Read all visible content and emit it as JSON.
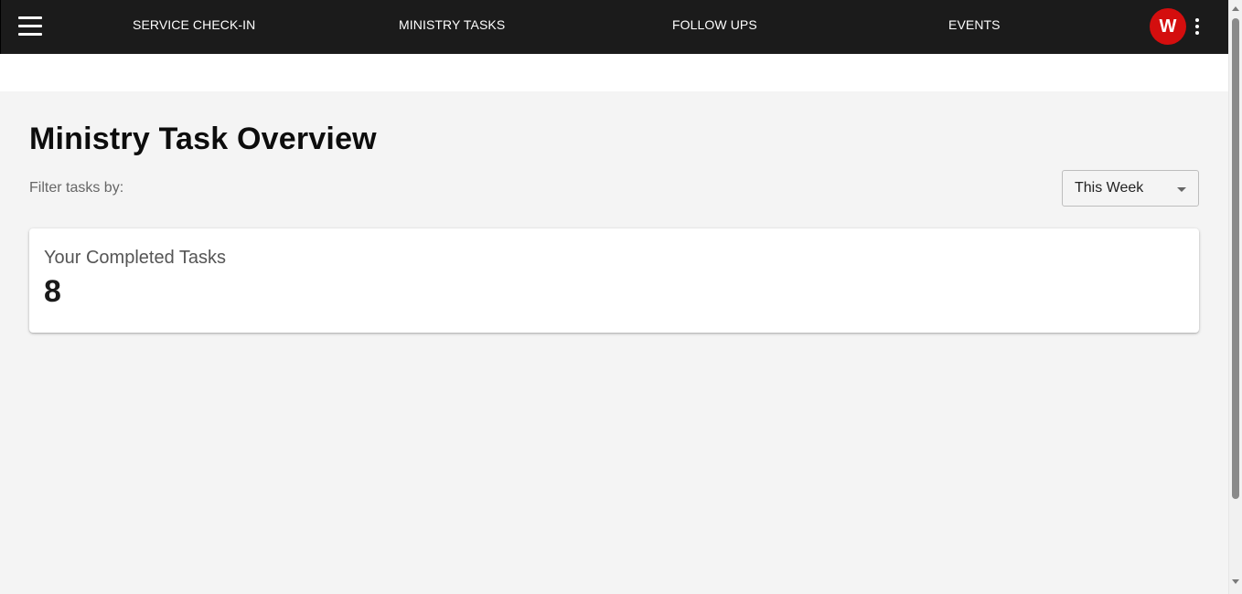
{
  "header": {
    "menu_icon": "hamburger-menu-icon",
    "nav": [
      {
        "label": "SERVICE CHECK-IN"
      },
      {
        "label": "MINISTRY TASKS"
      },
      {
        "label": "FOLLOW UPS"
      },
      {
        "label": "EVENTS"
      }
    ],
    "avatar_initial": "W",
    "avatar_color": "#d40e0e",
    "more_icon": "more-vertical-icon",
    "background_color": "#1b1b1b"
  },
  "main": {
    "title": "Ministry Task Overview",
    "filter_label": "Filter tasks by:",
    "filter_value": "This Week",
    "card": {
      "label": "Your Completed Tasks",
      "value": "8"
    }
  }
}
